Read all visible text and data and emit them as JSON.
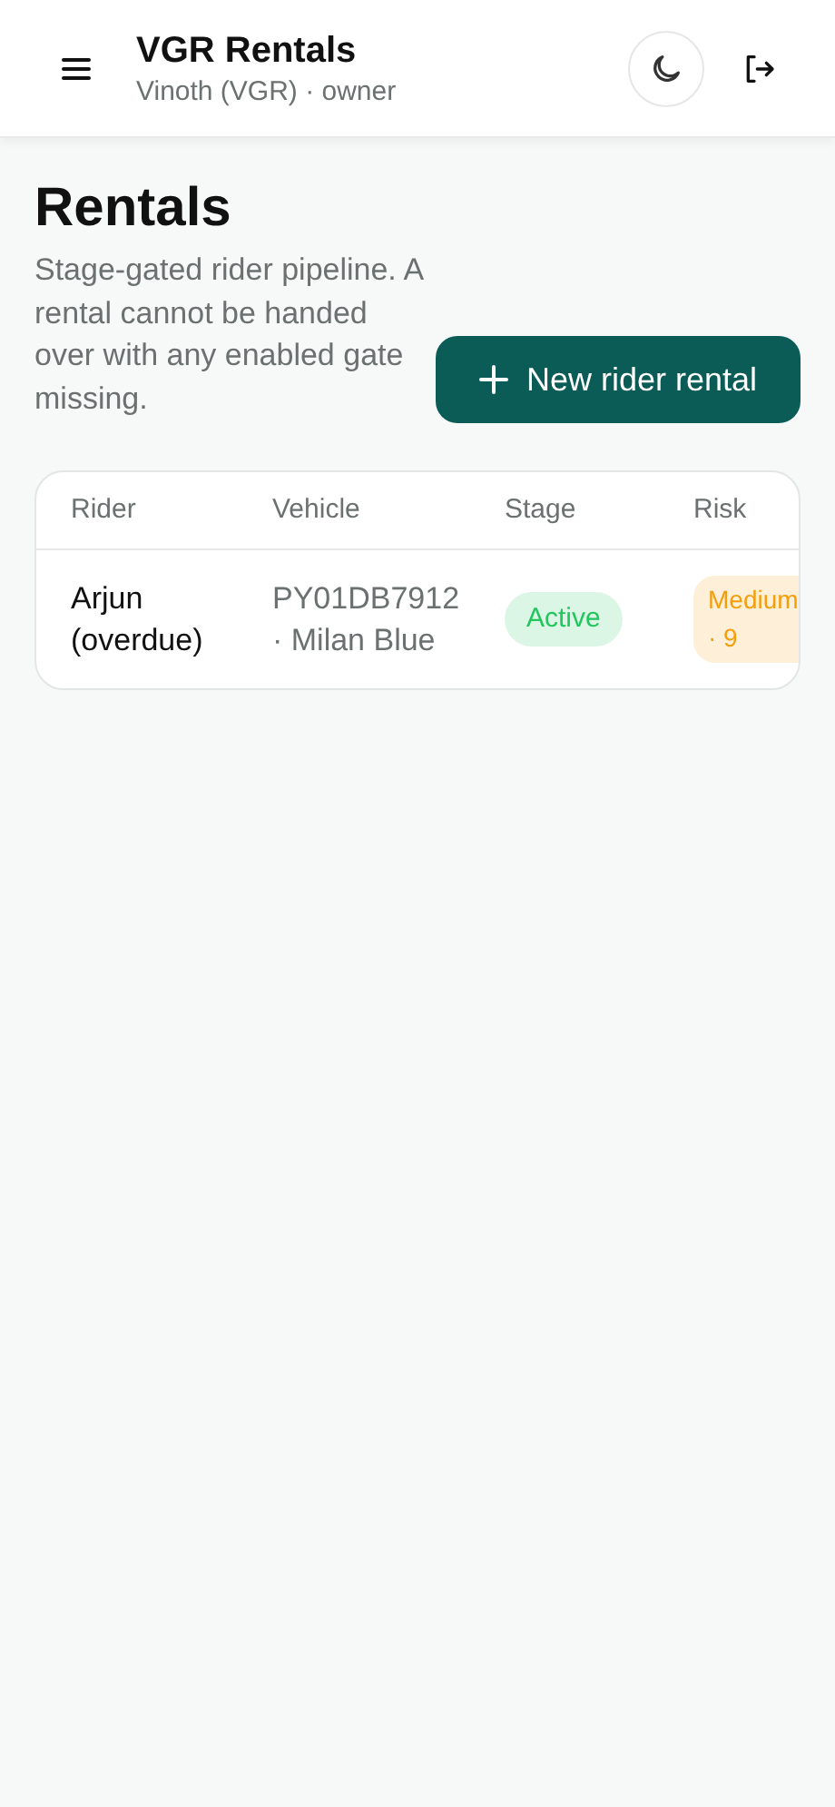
{
  "header": {
    "title": "VGR Rentals",
    "subtitle": "Vinoth (VGR) · owner"
  },
  "page": {
    "title": "Rentals",
    "description": "Stage-gated rider pipeline. A rental cannot be handed over with any enabled gate missing.",
    "primary_action": "New rider rental"
  },
  "table": {
    "columns": [
      "Rider",
      "Vehicle",
      "Stage",
      "Risk"
    ],
    "rows": [
      {
        "rider": "Arjun (overdue)",
        "vehicle": "PY01DB7912 · Milan Blue",
        "stage": {
          "text": "Active",
          "color": "#22c55e"
        },
        "risk": {
          "text": "Medium · 9",
          "color": "#f59e0b"
        }
      }
    ]
  }
}
